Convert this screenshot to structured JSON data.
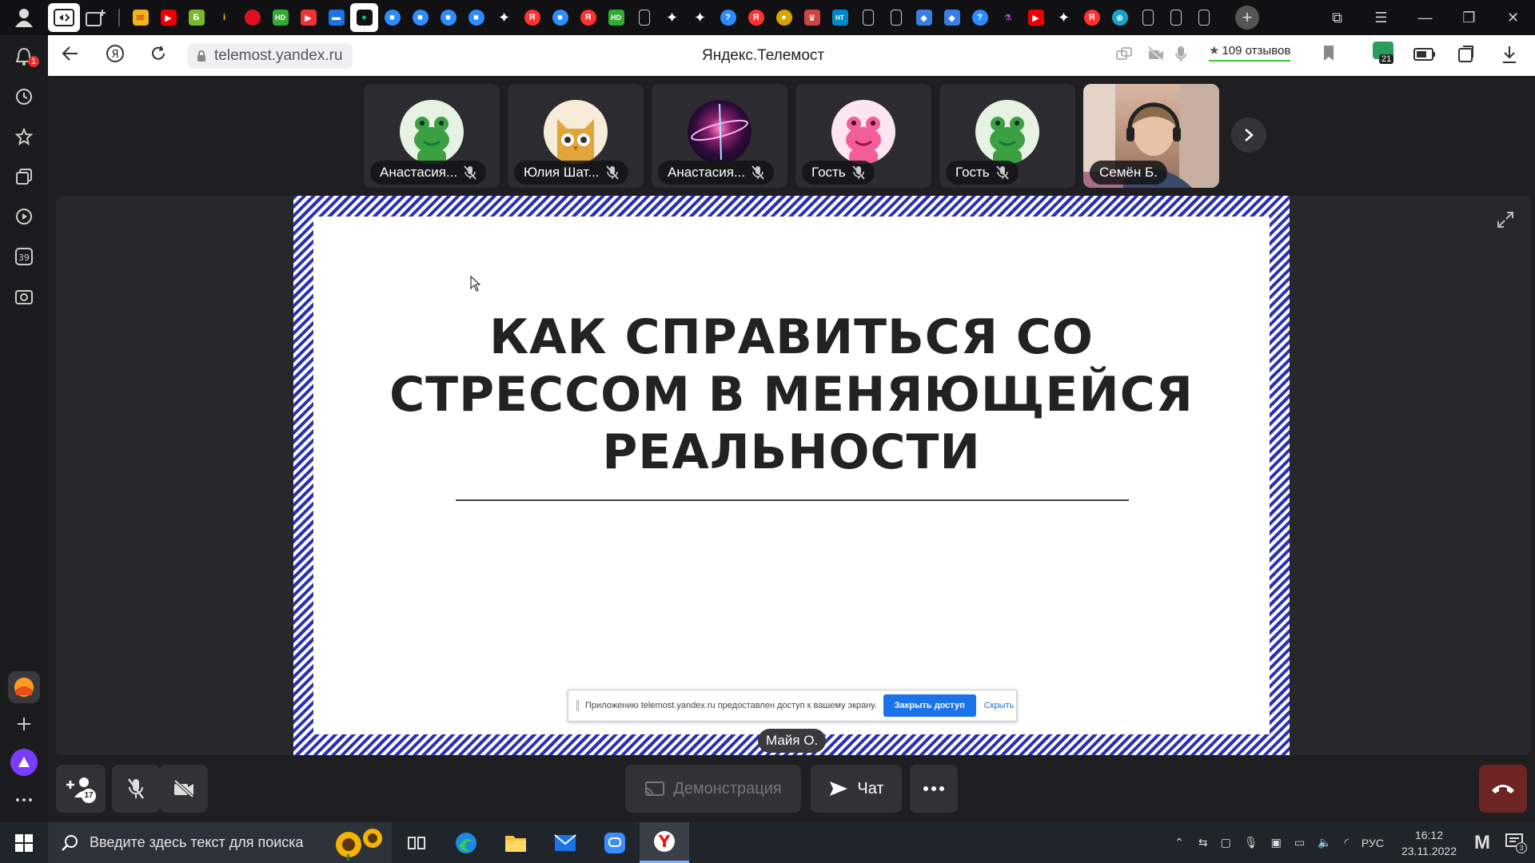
{
  "browser": {
    "address": {
      "url": "telemost.yandex.ru"
    },
    "page_title": "Яндекс.Телемост",
    "reviews": {
      "star": "★",
      "label": "109 отзывов"
    },
    "notifications_count": "1",
    "sidebar_calendar": "39",
    "downloads_badge": "21"
  },
  "participants": [
    {
      "name": "Анастасия...",
      "avatar": "frog-green"
    },
    {
      "name": "Юлия Шат...",
      "avatar": "owl"
    },
    {
      "name": "Анастасия...",
      "avatar": "galaxy"
    },
    {
      "name": "Гость",
      "avatar": "frog-pink"
    },
    {
      "name": "Гость",
      "avatar": "frog-green"
    },
    {
      "name": "Семён Б.",
      "avatar": "video"
    }
  ],
  "slide": {
    "title_lines": [
      "КАК СПРАВИТЬСЯ СО",
      "СТРЕССОМ В МЕНЯЮЩЕЙСЯ",
      "РЕАЛЬНОСТИ"
    ]
  },
  "share_banner": {
    "message": "Приложению telemost.yandex.ru предоставлен доступ к вашему экрану.",
    "stop_label": "Закрыть доступ",
    "hide_label": "Скрыть"
  },
  "speaker": "Майя О.",
  "controls": {
    "participants_count": "17",
    "demo_label": "Демонстрация",
    "chat_label": "Чат"
  },
  "taskbar": {
    "search_placeholder": "Введите здесь текст для поиска",
    "language": "РУС",
    "time": "16:12",
    "date": "23.11.2022",
    "notifications": "3"
  },
  "colors": {
    "accent_blue": "#1a73e8",
    "hangup_red": "#6e2424",
    "border_stripe": "#2a2fb8"
  }
}
